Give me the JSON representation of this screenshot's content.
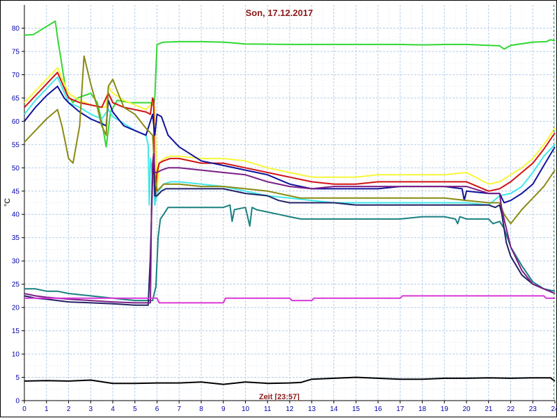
{
  "chart_data": {
    "type": "line",
    "title": "Son, 17.12.2017",
    "xlabel": "Zeit [23:57]",
    "ylabel": "°C",
    "xlim": [
      0,
      24
    ],
    "ylim": [
      0,
      85
    ],
    "xticks": [
      0,
      1,
      2,
      3,
      4,
      5,
      6,
      7,
      8,
      9,
      10,
      11,
      12,
      13,
      14,
      15,
      16,
      17,
      18,
      19,
      20,
      21,
      22,
      23,
      24
    ],
    "yticks": [
      0,
      5,
      10,
      15,
      20,
      25,
      30,
      35,
      40,
      45,
      50,
      55,
      60,
      65,
      70,
      75,
      80
    ],
    "grid": true,
    "current_time": 23.95,
    "series": [
      {
        "color": "#32d832",
        "x": [
          0,
          0.4,
          1.4,
          1.5,
          1.9,
          2.2,
          2.4,
          2.7,
          3.0,
          3.3,
          3.5,
          3.7,
          3.9,
          4.2,
          4.8,
          5.5,
          5.7,
          5.8,
          5.85,
          5.9,
          6.0,
          6.3,
          7,
          8,
          9,
          9.5,
          10,
          12,
          14,
          15,
          16,
          17,
          18,
          19,
          20,
          21,
          21.5,
          21.7,
          22,
          23,
          23.6,
          23.8,
          24
        ],
        "y": [
          78.5,
          78.6,
          81.5,
          78,
          66,
          64,
          65,
          65.5,
          66,
          64,
          60,
          54.5,
          62,
          64.5,
          64,
          64,
          64,
          63.5,
          63.5,
          65,
          76.5,
          77,
          77.1,
          77.1,
          77,
          76.8,
          76.6,
          76.5,
          76.5,
          76.5,
          76.5,
          76.5,
          76.4,
          76.5,
          76.5,
          76.3,
          76.2,
          75.5,
          76.3,
          77,
          77.1,
          77.5,
          77.3
        ]
      },
      {
        "color": "#f7f738",
        "x": [
          0,
          0.5,
          1,
          1.5,
          2,
          2.5,
          3,
          3.5,
          3.7,
          3.8,
          4,
          4.5,
          5,
          5.5,
          5.8,
          5.9,
          6.0,
          6.1,
          6.3,
          6.6,
          7,
          8,
          9,
          10,
          11,
          12,
          13,
          14,
          15,
          16,
          17,
          18,
          19,
          20,
          21,
          21.5,
          22,
          22.5,
          23,
          23.5,
          24
        ],
        "y": [
          64,
          66.5,
          69,
          71.5,
          66,
          64.5,
          63.5,
          63,
          63,
          67.5,
          66,
          64.5,
          63.5,
          62.5,
          64,
          63,
          45,
          51,
          52,
          52.5,
          52.5,
          52,
          52,
          51.5,
          50,
          49,
          48,
          48,
          48,
          48.5,
          48.5,
          48.5,
          48.5,
          49,
          46.5,
          47,
          48.5,
          50,
          52,
          55,
          58.5
        ]
      },
      {
        "color": "#d01414",
        "x": [
          0,
          0.5,
          1,
          1.5,
          2,
          2.5,
          3,
          3.5,
          3.8,
          4,
          4.5,
          5,
          5.5,
          5.7,
          5.8,
          5.85,
          5.9,
          6.0,
          6.1,
          6.3,
          6.6,
          7,
          8,
          9,
          10,
          11,
          12,
          13,
          14,
          15,
          16,
          17,
          18,
          19,
          20,
          21,
          21.5,
          22,
          22.5,
          23,
          23.5,
          24
        ],
        "y": [
          63,
          65.5,
          68,
          70.5,
          65,
          64,
          63.5,
          63,
          66,
          64,
          63,
          62.5,
          62,
          61.5,
          65,
          64.5,
          42,
          49,
          51,
          51.5,
          52,
          52,
          51,
          51,
          50,
          49,
          48,
          47,
          46.5,
          46.5,
          47,
          47,
          47,
          47,
          47,
          45,
          45.5,
          47,
          49,
          51,
          54,
          57.5
        ]
      },
      {
        "color": "#40e8e8",
        "x": [
          0,
          0.5,
          1,
          1.5,
          2,
          2.5,
          3,
          3.5,
          3.8,
          4,
          4.5,
          5,
          5.5,
          5.6,
          5.65,
          5.7,
          5.8,
          5.85,
          5.9,
          6.0,
          6.3,
          6.6,
          7,
          8,
          9,
          10,
          11,
          12,
          13,
          14,
          15,
          16,
          17,
          18,
          19,
          20,
          21,
          21.5,
          22,
          22.5,
          23,
          23.5,
          24
        ],
        "y": [
          61.5,
          64.5,
          67,
          69.5,
          64,
          63,
          61.5,
          60.5,
          62.5,
          61,
          59.5,
          58,
          57,
          55,
          42,
          52,
          48,
          48,
          42,
          44.5,
          46.5,
          47,
          47,
          46.5,
          46,
          45,
          44,
          43.5,
          43,
          42.5,
          42.5,
          42.5,
          42.5,
          42.5,
          42.5,
          42.5,
          42,
          44,
          44.5,
          46,
          49,
          52.5,
          55
        ]
      },
      {
        "color": "#12129a",
        "x": [
          0,
          0.5,
          1,
          1.5,
          1.8,
          2,
          2.5,
          3,
          3.5,
          3.7,
          3.8,
          4,
          4.5,
          5,
          5.5,
          5.8,
          5.9,
          6.0,
          6.2,
          6.5,
          7,
          8,
          9,
          10,
          11,
          12,
          12.5,
          13,
          14,
          15,
          16,
          17,
          18,
          19,
          19.8,
          19.9,
          20,
          21,
          21.5,
          21.7,
          22,
          22.5,
          23,
          23.5,
          24
        ],
        "y": [
          60,
          63,
          65.5,
          67.5,
          65,
          64,
          62,
          60.5,
          59.5,
          59,
          64.5,
          62,
          59,
          58,
          57,
          61.5,
          57,
          61.5,
          61,
          57,
          54.5,
          51.5,
          50.5,
          49.5,
          48.5,
          46.5,
          46,
          45.5,
          45.5,
          45.5,
          45.5,
          46,
          46,
          46,
          45.5,
          43,
          45,
          44.5,
          44.5,
          42.5,
          43,
          44.5,
          46.5,
          50.5,
          54.5
        ]
      },
      {
        "color": "#8a8a14",
        "x": [
          0,
          0.5,
          1,
          1.5,
          1.7,
          2,
          2.2,
          2.5,
          2.7,
          3,
          3.3,
          3.5,
          3.7,
          3.8,
          4.0,
          4.2,
          4.5,
          5,
          5.5,
          5.8,
          5.9,
          6.0,
          6.3,
          7,
          8,
          9,
          10,
          11,
          12,
          12.5,
          13,
          14,
          15,
          16,
          17,
          18,
          19,
          20,
          21,
          21.5,
          21.7,
          22,
          22.5,
          23,
          23.5,
          24
        ],
        "y": [
          55.5,
          58,
          60.5,
          62.5,
          59,
          52,
          51,
          59,
          74,
          68,
          63,
          59,
          57,
          67.5,
          69,
          66.5,
          63,
          61.5,
          58.5,
          57,
          49,
          45,
          46.5,
          46.5,
          46,
          46,
          45.5,
          45,
          44,
          43.5,
          43.5,
          43.5,
          43.5,
          43.5,
          43.5,
          43.5,
          43.5,
          43,
          42.5,
          42.5,
          40,
          38,
          41,
          43.5,
          46,
          49.5
        ]
      },
      {
        "color": "#1a8080",
        "x": [
          0,
          0.5,
          1,
          1.5,
          2,
          3,
          4,
          5,
          5.5,
          5.8,
          5.95,
          6.05,
          6.15,
          6.3,
          6.5,
          7,
          8,
          9,
          9.3,
          9.4,
          9.5,
          10,
          10.2,
          10.3,
          10.5,
          11,
          11.5,
          12,
          12.5,
          13,
          14,
          15,
          16,
          17,
          18,
          19,
          19.5,
          19.6,
          19.7,
          20,
          21,
          21.2,
          21.5,
          21.7,
          22,
          22.5,
          23,
          23.5,
          24
        ],
        "y": [
          24,
          24,
          23.5,
          23.5,
          23,
          22.5,
          22,
          21.5,
          21.5,
          21.5,
          24.5,
          35,
          39,
          40,
          41.5,
          41.5,
          41.5,
          41.5,
          42,
          38.5,
          41,
          41.5,
          37.5,
          41.5,
          41,
          40.5,
          40,
          39.5,
          39,
          39,
          39,
          39,
          39,
          39,
          39.5,
          39.5,
          39,
          38,
          39.5,
          39,
          39,
          38,
          38.5,
          37,
          33,
          29,
          25.5,
          24,
          23.5
        ]
      },
      {
        "color": "#222266",
        "x": [
          0,
          0.5,
          1,
          1.5,
          2,
          3,
          4,
          5,
          5.6,
          5.7,
          5.8,
          5.85,
          5.9,
          6.0,
          6.2,
          6.4,
          7,
          8,
          9,
          10,
          11,
          11.5,
          12,
          13,
          14,
          15,
          16,
          17,
          18,
          19,
          20,
          21,
          21.3,
          21.5,
          21.6,
          21.8,
          22,
          22.5,
          23,
          23.5,
          24
        ],
        "y": [
          22.5,
          22,
          21.8,
          21.5,
          21.2,
          21,
          20.8,
          20.5,
          20.5,
          31,
          48,
          53,
          44,
          44,
          45,
          45.5,
          45.5,
          45.5,
          45.5,
          44.5,
          44,
          43,
          42.5,
          42.5,
          42.5,
          42,
          42,
          42,
          42,
          42,
          42,
          42,
          41.5,
          42,
          40,
          34,
          31,
          27,
          25,
          24,
          23
        ]
      },
      {
        "color": "#7b1f86",
        "x": [
          0,
          0.5,
          1,
          1.5,
          2,
          3,
          4,
          5,
          5.7,
          5.75,
          5.8,
          5.85,
          5.9,
          6.0,
          6.2,
          6.5,
          7,
          8,
          9,
          10,
          11,
          12,
          13,
          14,
          15,
          16,
          17,
          18,
          19,
          20,
          21,
          21.5,
          21.6,
          22,
          22.5,
          23,
          23.5,
          24
        ],
        "y": [
          23,
          22.5,
          22.2,
          22,
          21.8,
          21.5,
          21.2,
          21,
          21,
          41,
          51,
          53,
          49,
          49,
          49.5,
          50,
          50,
          49.5,
          49,
          48.5,
          47,
          46,
          45.5,
          46,
          46,
          46,
          46,
          46,
          46,
          46,
          44.5,
          44.5,
          41,
          33,
          28,
          25,
          24,
          23
        ]
      },
      {
        "color": "#d838d8",
        "x": [
          0,
          6.0,
          6.1,
          9,
          9.1,
          12,
          12.1,
          13,
          13.1,
          17,
          17.1,
          23.5,
          23.6,
          24
        ],
        "y": [
          22,
          22,
          21,
          21,
          22,
          22,
          21.5,
          21.5,
          22,
          22,
          22.5,
          22.5,
          22,
          22
        ]
      },
      {
        "color": "#000000",
        "x": [
          0,
          1,
          2,
          3,
          4,
          5,
          6,
          7,
          8,
          9,
          10,
          11,
          12,
          12.5,
          13,
          14,
          15,
          16,
          17,
          18,
          19,
          20,
          21,
          22,
          23,
          23.8,
          24
        ],
        "y": [
          4.2,
          4.3,
          4.2,
          4.4,
          3.7,
          3.7,
          3.8,
          3.8,
          4.0,
          3.5,
          4.0,
          3.7,
          3.8,
          3.9,
          4.6,
          4.8,
          5.0,
          4.8,
          4.6,
          4.6,
          4.8,
          4.8,
          4.9,
          4.8,
          4.9,
          4.9,
          4.2
        ]
      }
    ]
  }
}
